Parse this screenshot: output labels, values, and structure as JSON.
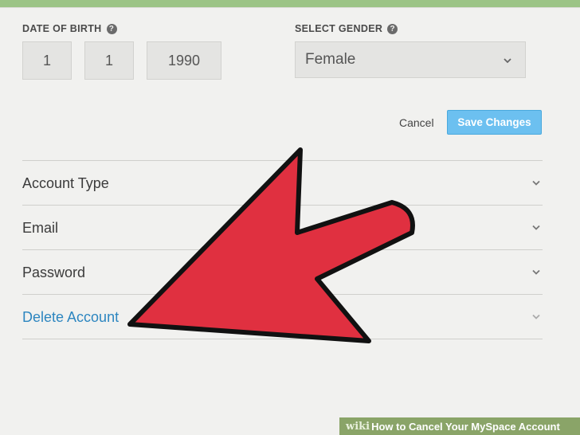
{
  "dob": {
    "label": "DATE OF BIRTH",
    "help_icon": "question-circle-icon",
    "month": "1",
    "day": "1",
    "year": "1990"
  },
  "gender": {
    "label": "SELECT GENDER",
    "help_icon": "question-circle-icon",
    "selected": "Female"
  },
  "actions": {
    "cancel_label": "Cancel",
    "save_label": "Save Changes"
  },
  "sections": [
    {
      "label": "Account Type"
    },
    {
      "label": "Email"
    },
    {
      "label": "Password"
    },
    {
      "label": "Delete Account"
    }
  ],
  "overlay": {
    "arrow_color": "#e03040"
  },
  "footer": {
    "brand": "wiki",
    "brand_suffix": "How",
    "title": " to Cancel Your MySpace Account"
  },
  "colors": {
    "accent_green": "#9cc486",
    "save_button": "#6cc0f0",
    "link_blue": "#2d86c0"
  }
}
